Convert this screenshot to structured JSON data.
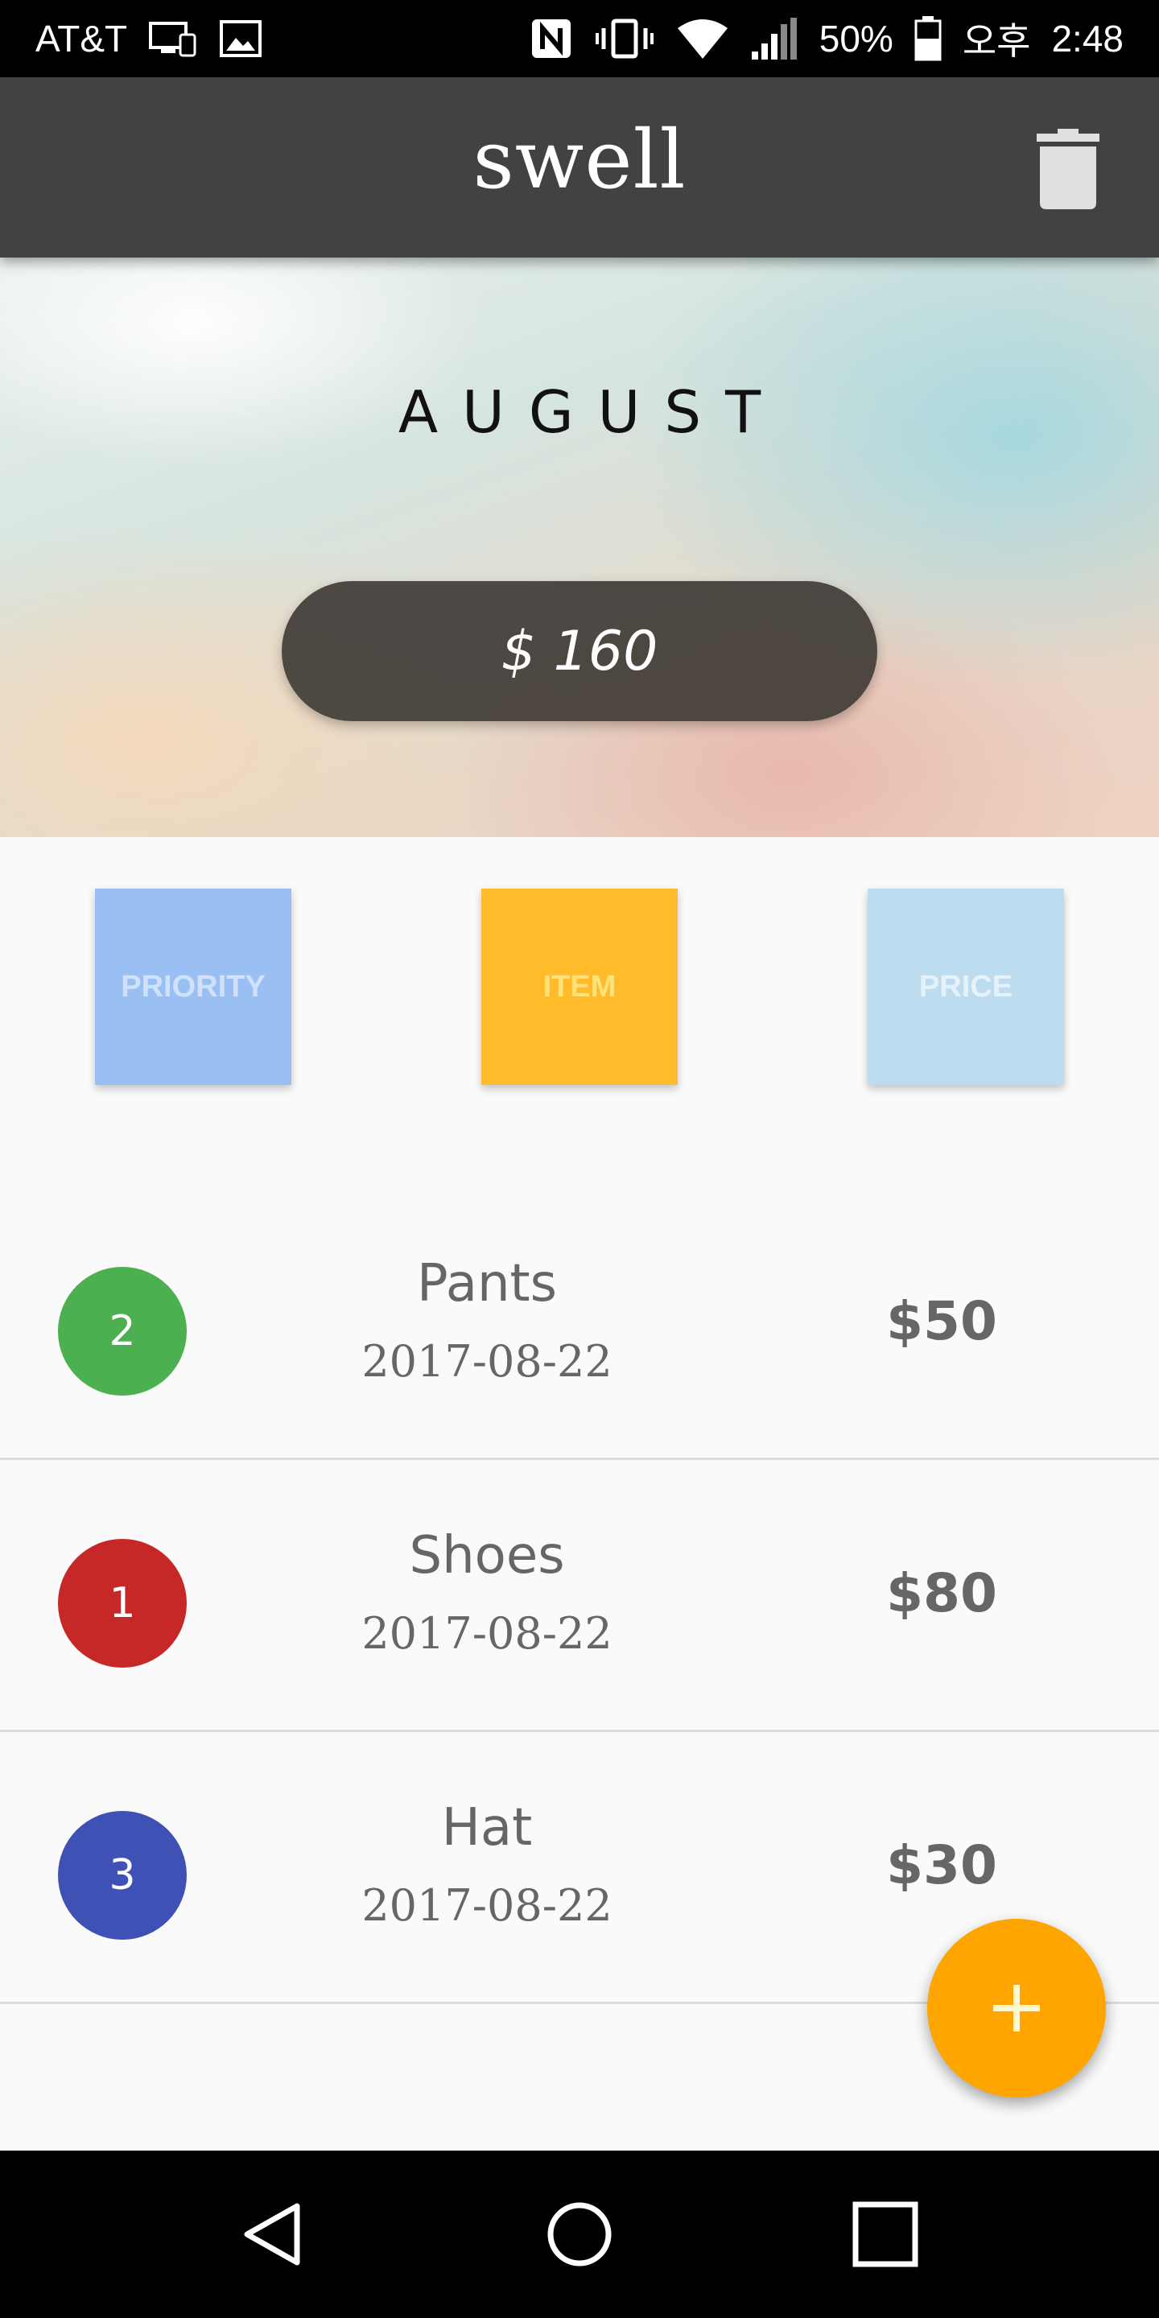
{
  "status_bar": {
    "carrier": "AT&T",
    "battery": "50%",
    "time_prefix": "오후",
    "time": "2:48"
  },
  "app_bar": {
    "title": "swell",
    "delete_icon": "trash-icon"
  },
  "hero": {
    "month": "AUGUST",
    "total": "$ 160"
  },
  "sort_buttons": [
    {
      "label": "PRIORITY",
      "color": "#9abff3"
    },
    {
      "label": "ITEM",
      "color": "#ffbb2a"
    },
    {
      "label": "PRICE",
      "color": "#bedcef"
    }
  ],
  "items": [
    {
      "priority": "2",
      "priority_color": "#4caf50",
      "name": "Pants",
      "date": "2017-08-22",
      "price": "$50"
    },
    {
      "priority": "1",
      "priority_color": "#c62828",
      "name": "Shoes",
      "date": "2017-08-22",
      "price": "$80"
    },
    {
      "priority": "3",
      "priority_color": "#3f51b5",
      "name": "Hat",
      "date": "2017-08-22",
      "price": "$30"
    }
  ],
  "fab": {
    "icon": "plus-icon",
    "color": "#ffa500"
  },
  "nav_bar": {
    "icons": [
      "back-icon",
      "home-icon",
      "recents-icon"
    ]
  }
}
